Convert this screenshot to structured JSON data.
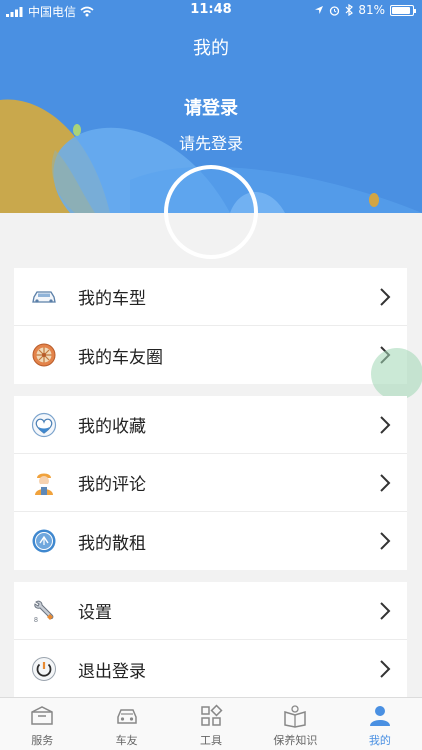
{
  "status_bar": {
    "carrier": "中国电信",
    "time": "11:48",
    "battery": "81%"
  },
  "header": {
    "title": "我的",
    "login_title": "请登录",
    "login_subtitle": "请先登录"
  },
  "groups": [
    {
      "items": [
        {
          "label": "我的车型",
          "icon": "car-icon"
        },
        {
          "label": "我的车友圈",
          "icon": "wheel-icon"
        }
      ]
    },
    {
      "items": [
        {
          "label": "我的收藏",
          "icon": "heart-icon"
        },
        {
          "label": "我的评论",
          "icon": "worker-icon"
        },
        {
          "label": "我的散租",
          "icon": "rental-icon"
        }
      ]
    },
    {
      "items": [
        {
          "label": "设置",
          "icon": "wrench-icon"
        },
        {
          "label": "退出登录",
          "icon": "power-icon"
        }
      ]
    }
  ],
  "tabbar": {
    "tabs": [
      {
        "label": "服务",
        "icon": "box-icon"
      },
      {
        "label": "车友",
        "icon": "car-front-icon"
      },
      {
        "label": "工具",
        "icon": "grid-icon"
      },
      {
        "label": "保养知识",
        "icon": "book-icon"
      },
      {
        "label": "我的",
        "icon": "person-icon",
        "active": true
      }
    ]
  },
  "colors": {
    "accent": "#4a90e2",
    "page_bg": "#f2f2f2"
  }
}
